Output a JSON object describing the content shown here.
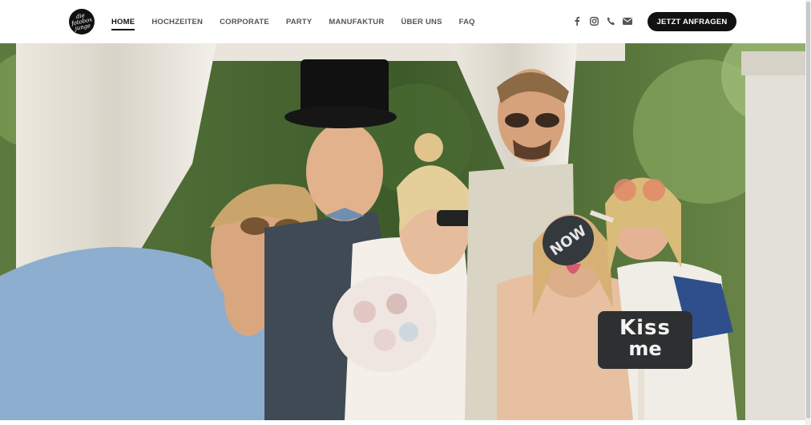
{
  "logo": {
    "text": "die fotobox junge"
  },
  "nav": {
    "items": [
      {
        "label": "HOME",
        "active": true
      },
      {
        "label": "HOCHZEITEN",
        "active": false
      },
      {
        "label": "CORPORATE",
        "active": false
      },
      {
        "label": "PARTY",
        "active": false
      },
      {
        "label": "MANUFAKTUR",
        "active": false
      },
      {
        "label": "ÜBER UNS",
        "active": false
      },
      {
        "label": "FAQ",
        "active": false
      }
    ]
  },
  "social_icons": [
    "facebook-icon",
    "instagram-icon",
    "phone-icon",
    "mail-icon"
  ],
  "cta": {
    "label": "JETZT ANFRAGEN"
  },
  "hero": {
    "sign_kiss_line1": "Kiss",
    "sign_kiss_line2": "me",
    "sign_now": "NOW"
  },
  "colors": {
    "header_bg": "#ffffff",
    "cta_bg": "#111111",
    "nav_text": "#555555",
    "nav_active": "#111111"
  }
}
